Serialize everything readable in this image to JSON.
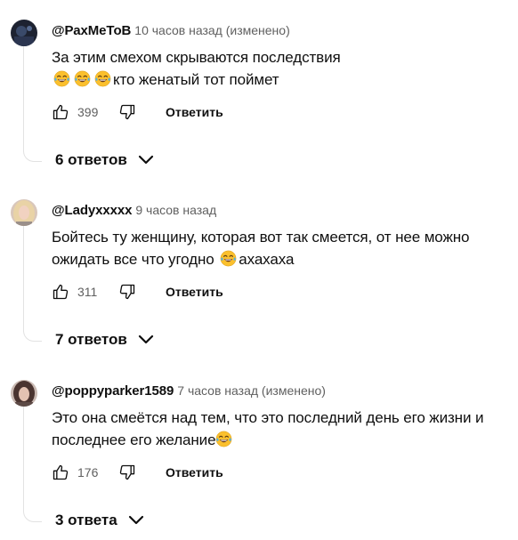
{
  "comments": [
    {
      "author": "@РахМеТоВ",
      "time": "10 часов назад (изменено)",
      "text_before": "За этим смехом скрываются последствия",
      "emoji_count": 3,
      "text_after": "кто женатый тот поймет",
      "likes": "399",
      "reply_label": "Ответить",
      "replies_label": "6 ответов",
      "avatar_icon": "avatar-dark-icon"
    },
    {
      "author": "@Ladyxxxxx",
      "time": "9 часов назад",
      "text_before": "Бойтесь ту женщину, которая вот так смеется, от нее можно ожидать все что угодно",
      "emoji_count": 1,
      "text_after": "ахахаха",
      "likes": "311",
      "reply_label": "Ответить",
      "replies_label": "7 ответов",
      "avatar_icon": "avatar-blonde-icon"
    },
    {
      "author": "@poppyparker1589",
      "time": "7 часов назад (изменено)",
      "text_before": "Это она смеётся над тем, что это последний день его жизни и последнее его желание",
      "emoji_count": 1,
      "text_after": "",
      "likes": "176",
      "reply_label": "Ответить",
      "replies_label": "3 ответа",
      "avatar_icon": "avatar-brunette-icon"
    }
  ],
  "colors": {
    "text": "#0f0f0f",
    "secondary": "#606060",
    "thread_line": "#e2e2e2",
    "emoji_face": "#fbc02d"
  }
}
